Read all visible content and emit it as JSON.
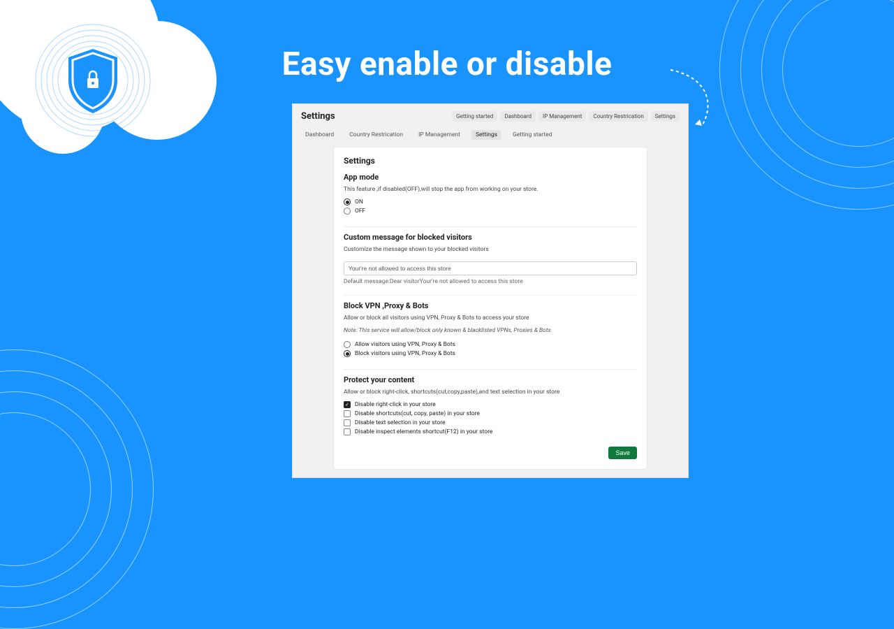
{
  "hero": {
    "title": "Easy enable or disable"
  },
  "window": {
    "title": "Settings",
    "pills": [
      "Getting started",
      "Dashboard",
      "IP Management",
      "Country Restrication",
      "Settings"
    ],
    "tabs": [
      {
        "label": "Dashboard",
        "active": false
      },
      {
        "label": "Country Restrication",
        "active": false
      },
      {
        "label": "IP Management",
        "active": false
      },
      {
        "label": "Settings",
        "active": true
      },
      {
        "label": "Getting started",
        "active": false
      }
    ],
    "panel_title": "Settings",
    "app_mode": {
      "heading": "App mode",
      "desc": "This feature ,if disabled(OFF),will stop the app from working on your store.",
      "opt_on": "ON",
      "opt_off": "OFF"
    },
    "custom_msg": {
      "heading": "Custom message for blocked visitors",
      "desc": "Customize the message shown to your blocked visitors",
      "value": "Your're not allowed to access this store",
      "hint": "Default message:Dear visitorYour're not allowed to access this store"
    },
    "vpn": {
      "heading": "Block VPN ,Proxy & Bots",
      "desc": "Allow or block all visitors using VPN, Proxy & Bots to access your store",
      "note": "Note: This service will allow/block only known & blacklisted VPNs, Proxies & Bots",
      "opt_allow": "Allow visitors using VPN, Proxy & Bots",
      "opt_block": "Block visitors using VPN, Proxy & Bots"
    },
    "protect": {
      "heading": "Protect your content",
      "desc": "Allow or block right-click, shortcuts(cut,copy,paste),and text selection in your store",
      "chk_rightclick": "Disable right-click in your store",
      "chk_shortcuts": "Disable shortcuts(cut, copy, paste) in your store",
      "chk_textsel": "Disable text selection in your store",
      "chk_inspect": "Disable inspect elements shortcut(F12) in your store"
    },
    "save_label": "Save"
  }
}
